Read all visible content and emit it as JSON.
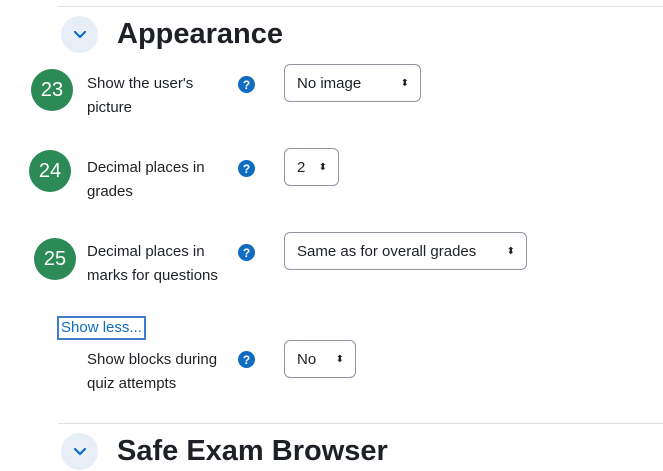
{
  "sections": {
    "appearance": {
      "title": "Appearance",
      "toggle_icon": "chevron-down-icon"
    },
    "safe_exam_browser": {
      "title": "Safe Exam Browser",
      "toggle_icon": "chevron-down-icon"
    }
  },
  "fields": {
    "show_picture": {
      "badge": "23",
      "label": "Show the user's picture",
      "value": "No image"
    },
    "decimal_grades": {
      "badge": "24",
      "label": "Decimal places in grades",
      "value": "2"
    },
    "decimal_marks": {
      "badge": "25",
      "label": "Decimal places in marks for questions",
      "value": "Same as for overall grades"
    },
    "show_blocks": {
      "label": "Show blocks during quiz attempts",
      "value": "No"
    }
  },
  "help_icon_glyph": "?",
  "caret_glyph": "⬍",
  "show_less_link": "Show less...",
  "colors": {
    "badge": "#2b8a55",
    "help_icon": "#0f6cbf",
    "link": "#0f6cbf",
    "chevron_bg": "#e8eef7"
  }
}
